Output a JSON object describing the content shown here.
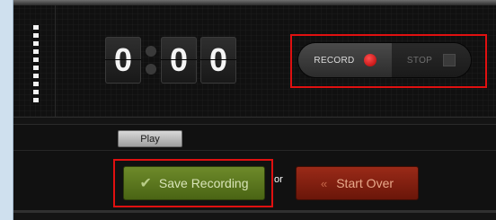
{
  "timer": {
    "digits": [
      "0",
      "0",
      "0"
    ]
  },
  "recorder": {
    "record_label": "RECORD",
    "stop_label": "STOP"
  },
  "playback": {
    "play_label": "Play"
  },
  "actions": {
    "save_label": "Save Recording",
    "or_text": "or",
    "start_over_label": "Start Over"
  },
  "icons": {
    "record": "record-dot-icon",
    "stop": "stop-square-icon",
    "save": "checkmark-icon",
    "start_over": "rewind-icon"
  },
  "colors": {
    "highlight": "#e01010",
    "record_dot": "#e02020",
    "save_green": "#5a7420",
    "start_over_red": "#8a2010"
  }
}
